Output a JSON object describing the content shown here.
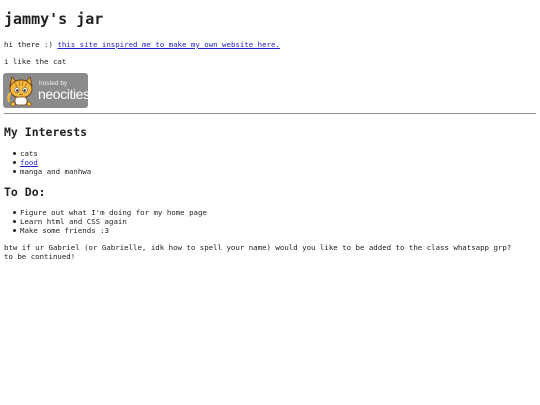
{
  "header": {
    "title": "jammy's jar"
  },
  "intro": {
    "greeting": "hi there :)",
    "inspired_link": "this site inspired me to make my own website here.",
    "cat_line": "i like the cat"
  },
  "badge": {
    "hosted_text": "hosted by",
    "brand_text": "neocities",
    "background_color": "#8b8b8b"
  },
  "interests": {
    "heading": "My Interests",
    "items": [
      {
        "label": "cats",
        "is_link": false
      },
      {
        "label": "food",
        "is_link": true
      },
      {
        "label": "manga and manhwa",
        "is_link": false
      }
    ]
  },
  "todo": {
    "heading": "To Do:",
    "items": [
      "Figure out what I'm doing for my home page",
      "Learn html and CSS again",
      "Make some friends :3"
    ]
  },
  "footer": {
    "question": "btw if ur Gabriel (or Gabrielle, idk how to spell your name) would you like to be added to the class whatsapp grp?",
    "continued": "to be continued!"
  },
  "colors": {
    "link": "#2323c8",
    "text": "#222222",
    "divider": "#8a8a8a"
  }
}
